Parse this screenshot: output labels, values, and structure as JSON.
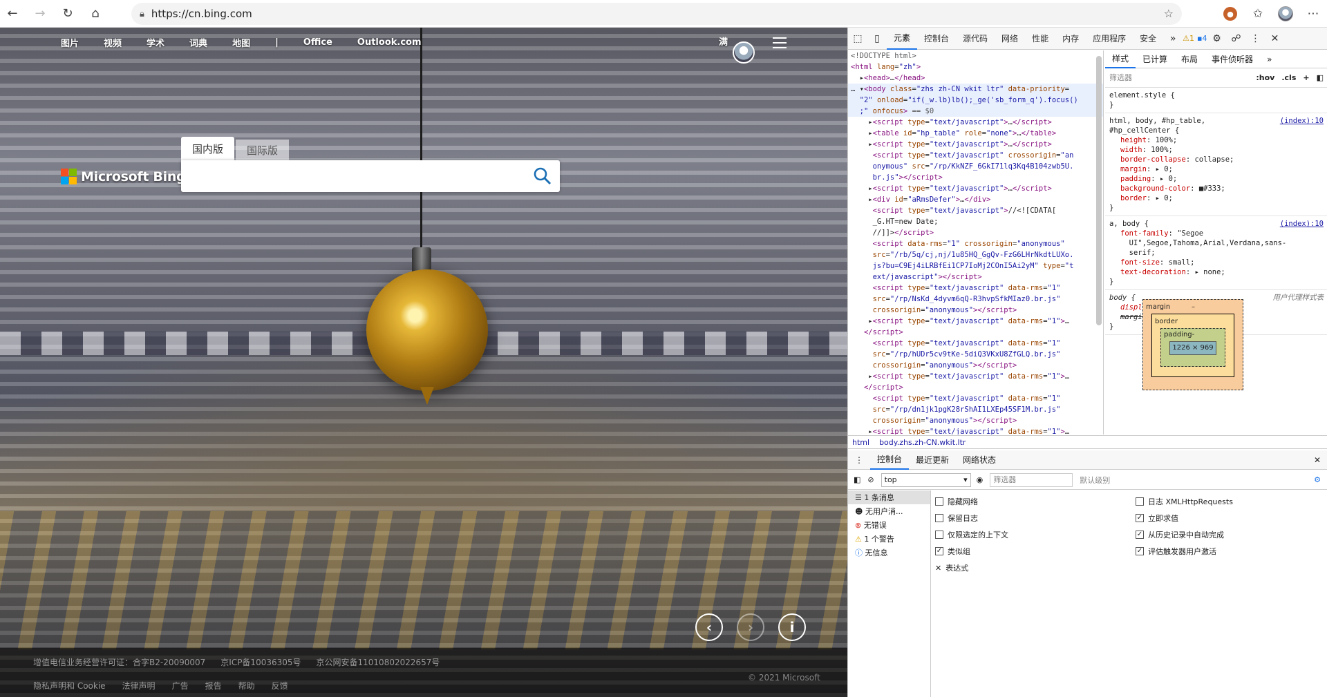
{
  "browser": {
    "url": "https://cn.bing.com"
  },
  "bing": {
    "nav": [
      "图片",
      "视频",
      "学术",
      "词典",
      "地图",
      "|",
      "Office",
      "Outlook.com"
    ],
    "user_name": "满",
    "logo_text": "Microsoft Bing",
    "tabs": [
      "国内版",
      "国际版"
    ],
    "search_placeholder": "",
    "footer_line1": [
      "增值电信业务经营许可证：合字B2-20090007",
      "京ICP备10036305号",
      "京公网安备11010802022657号"
    ],
    "footer_line2": [
      "隐私声明和 Cookie",
      "法律声明",
      "广告",
      "报告",
      "帮助",
      "反馈"
    ],
    "copyright": "© 2021 Microsoft"
  },
  "devtools": {
    "tabs": [
      "元素",
      "控制台",
      "源代码",
      "网络",
      "性能",
      "内存",
      "应用程序",
      "安全"
    ],
    "warn_count": "1",
    "msg_count": "4",
    "style_tabs": [
      "样式",
      "已计算",
      "布局",
      "事件侦听器"
    ],
    "filter_placeholder": "筛选器",
    "hov": ":hov",
    "cls": ".cls",
    "breadcrumb": [
      "html",
      "body.zhs.zh-CN.wkit.ltr"
    ],
    "box": {
      "margin": "margin",
      "border": "border",
      "padding": "padding-",
      "content": "1226 × 969",
      "dash": "–"
    },
    "console_tabs": [
      "控制台",
      "最近更新",
      "网络状态"
    ],
    "context": "top",
    "console_filter": "筛选器",
    "levels": "默认级别",
    "console_side": [
      "1 条消息",
      "无用户消...",
      "无错误",
      "1 个警告",
      "无信息"
    ],
    "opts_left": [
      "隐藏网络",
      "保留日志",
      "仅限选定的上下文",
      "类似组",
      "表达式"
    ],
    "opts_right": [
      "日志 XMLHttpRequests",
      "立即求值",
      "从历史记录中自动完成",
      "评估触发器用户激活"
    ]
  }
}
